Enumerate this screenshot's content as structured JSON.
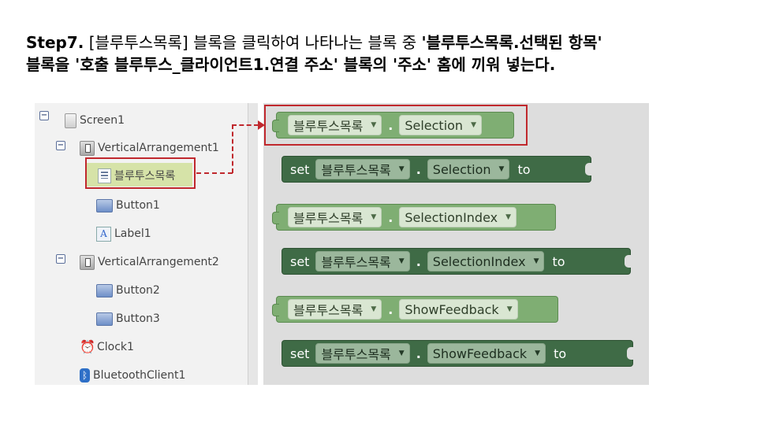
{
  "instruction": {
    "step": "Step7.",
    "line1_a": " [블루투스목록] 블록을 클릭하여 나타나는 블록 중 ",
    "line1_b": "'블루투스목록.선택된 항목'",
    "line2": "블록을 '호출 블루투스_클라이언트1.연결 주소' 블록의 '주소' 홈에 끼워 넣는다."
  },
  "tree": {
    "items": [
      {
        "label": "Screen1",
        "icon": "screen-icon",
        "toggle": "⊟"
      },
      {
        "label": "VerticalArrangement1",
        "icon": "vertical-arrangement-icon",
        "toggle": "⊟"
      },
      {
        "label": "블루투스목록",
        "icon": "listpicker-icon",
        "selected": true
      },
      {
        "label": "Button1",
        "icon": "button-icon"
      },
      {
        "label": "Label1",
        "icon": "label-icon"
      },
      {
        "label": "VerticalArrangement2",
        "icon": "vertical-arrangement-icon",
        "toggle": "⊟"
      },
      {
        "label": "Button2",
        "icon": "button-icon"
      },
      {
        "label": "Button3",
        "icon": "button-icon"
      },
      {
        "label": "Clock1",
        "icon": "clock-icon"
      },
      {
        "label": "BluetoothClient1",
        "icon": "bluetooth-icon"
      }
    ]
  },
  "blocks": {
    "component": "블루투스목록",
    "dot": ".",
    "set_kw": "set",
    "to_kw": "to",
    "props": [
      "Selection",
      "SelectionIndex",
      "ShowFeedback"
    ],
    "arrow": "▼"
  },
  "colors": {
    "getter": "#7fae73",
    "setter": "#3f6b46",
    "highlight": "#c0282d",
    "selected_bg": "#d6e3a8"
  }
}
